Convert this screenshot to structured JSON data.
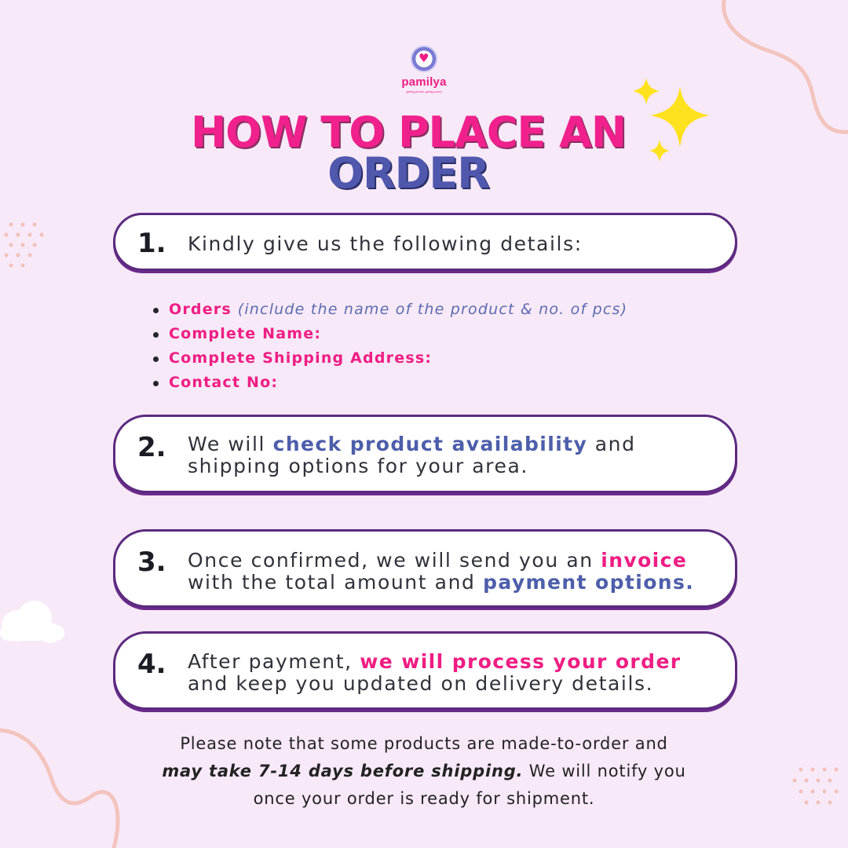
{
  "brand": {
    "name": "pamilya",
    "tagline": "giving proud, going proud"
  },
  "title": {
    "line1": "HOW TO PLACE  AN",
    "line2": "ORDER"
  },
  "steps": [
    {
      "number": "1.",
      "text": "Kindly give us the following details:"
    },
    {
      "number": "2.",
      "before": "We will ",
      "highlight": "check product availability",
      "after": " and shipping options for your area."
    },
    {
      "number": "3.",
      "before": "Once confirmed, we will send you an ",
      "highlight1": "invoice",
      "middle": " with the total amount and ",
      "highlight2": "payment options."
    },
    {
      "number": "4.",
      "before": "After payment, ",
      "highlight": "we will process your order",
      "after": " and keep you updated on delivery details."
    }
  ],
  "details": [
    {
      "label": "Orders",
      "note": "(include the name of the product & no. of pcs)"
    },
    {
      "label": "Complete Name:"
    },
    {
      "label": "Complete Shipping Address:"
    },
    {
      "label": "Contact No:"
    }
  ],
  "footer": {
    "line1": "Please note that some products are made-to-order and",
    "bold": "may take 7-14 days before shipping.",
    "line2_rest": " We will notify you",
    "line3": "once your order is ready for shipment."
  },
  "colors": {
    "background": "#f7e9f8",
    "pink": "#ef1d83",
    "blue": "#4d5eaa",
    "purple_border": "#5b2a7f",
    "star": "#ffe21f"
  },
  "icons": [
    "heart-logo-icon",
    "sparkle-icon",
    "cloud-icon",
    "dots-icon",
    "squiggle-icon"
  ]
}
